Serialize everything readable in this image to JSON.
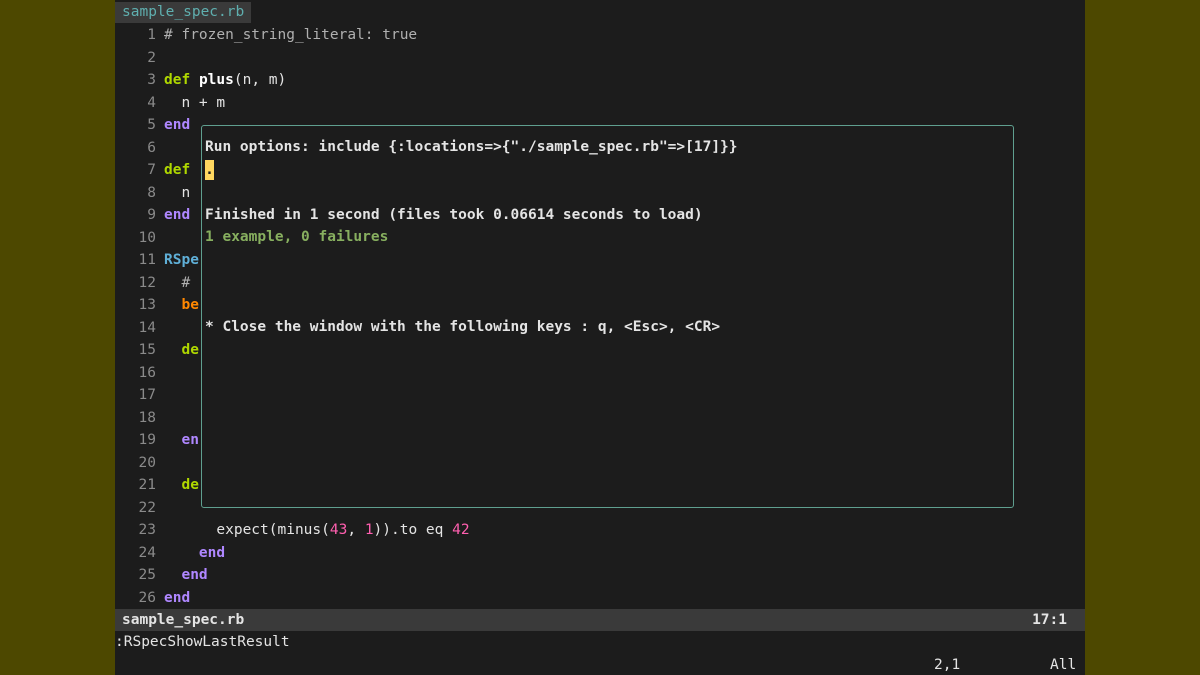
{
  "tab": {
    "label": "sample_spec.rb"
  },
  "code_lines": [
    {
      "n": "1",
      "parts": [
        {
          "t": "# frozen_string_literal: true",
          "c": "comment"
        }
      ]
    },
    {
      "n": "2",
      "parts": []
    },
    {
      "n": "3",
      "parts": [
        {
          "t": "def",
          "c": "kw"
        },
        {
          "t": " ",
          "c": ""
        },
        {
          "t": "plus",
          "c": "fn"
        },
        {
          "t": "(n, m)",
          "c": ""
        }
      ]
    },
    {
      "n": "4",
      "parts": [
        {
          "t": "  n + m",
          "c": ""
        }
      ]
    },
    {
      "n": "5",
      "parts": [
        {
          "t": "end",
          "c": "kw-end"
        }
      ]
    },
    {
      "n": "6",
      "parts": []
    },
    {
      "n": "7",
      "parts": [
        {
          "t": "def",
          "c": "kw"
        }
      ]
    },
    {
      "n": "8",
      "parts": [
        {
          "t": "  n",
          "c": ""
        }
      ]
    },
    {
      "n": "9",
      "parts": [
        {
          "t": "end",
          "c": "kw-end"
        }
      ]
    },
    {
      "n": "10",
      "parts": []
    },
    {
      "n": "11",
      "parts": [
        {
          "t": "RSpe",
          "c": "const"
        }
      ]
    },
    {
      "n": "12",
      "parts": [
        {
          "t": "  #",
          "c": "comment"
        }
      ]
    },
    {
      "n": "13",
      "parts": [
        {
          "t": "  ",
          "c": ""
        },
        {
          "t": "be",
          "c": "kw-be"
        }
      ]
    },
    {
      "n": "14",
      "parts": []
    },
    {
      "n": "15",
      "parts": [
        {
          "t": "  ",
          "c": ""
        },
        {
          "t": "de",
          "c": "kw"
        }
      ]
    },
    {
      "n": "16",
      "parts": []
    },
    {
      "n": "17",
      "parts": []
    },
    {
      "n": "18",
      "parts": []
    },
    {
      "n": "19",
      "parts": [
        {
          "t": "  ",
          "c": ""
        },
        {
          "t": "en",
          "c": "kw-end"
        }
      ]
    },
    {
      "n": "20",
      "parts": []
    },
    {
      "n": "21",
      "parts": [
        {
          "t": "  ",
          "c": ""
        },
        {
          "t": "de",
          "c": "kw"
        }
      ]
    },
    {
      "n": "22",
      "parts": []
    },
    {
      "n": "23",
      "parts": [
        {
          "t": "      expect(minus(",
          "c": ""
        },
        {
          "t": "43",
          "c": "num"
        },
        {
          "t": ", ",
          "c": ""
        },
        {
          "t": "1",
          "c": "num"
        },
        {
          "t": ")).to eq ",
          "c": ""
        },
        {
          "t": "42",
          "c": "num"
        }
      ]
    },
    {
      "n": "24",
      "parts": [
        {
          "t": "    ",
          "c": ""
        },
        {
          "t": "end",
          "c": "kw-end"
        }
      ]
    },
    {
      "n": "25",
      "parts": [
        {
          "t": "  ",
          "c": ""
        },
        {
          "t": "end",
          "c": "kw-end"
        }
      ]
    },
    {
      "n": "26",
      "parts": [
        {
          "t": "end",
          "c": "kw-end"
        }
      ]
    }
  ],
  "popup": {
    "run_options": "Run options: include {:locations=>{\"./sample_spec.rb\"=>[17]}}",
    "progress": ".",
    "finished": "Finished in 1 second (files took 0.06614 seconds to load)",
    "summary": "1 example, 0 failures",
    "close_hint": "* Close the window with the following keys : q, <Esc>, <CR>"
  },
  "statusline": {
    "filename": "sample_spec.rb",
    "position": "17:1"
  },
  "cmdline": {
    "command": ":RSpecShowLastResult"
  },
  "ruler": {
    "position": "2,1",
    "scroll": "All"
  },
  "colors": {
    "background_outer": "#4d4800",
    "editor_bg": "#1c1c1c",
    "keyword": "#afd700",
    "end_keyword": "#af87ff",
    "number": "#ff5faf",
    "success": "#87af5f",
    "cursor": "#ffd75f",
    "popup_border": "#5f9f8f"
  }
}
